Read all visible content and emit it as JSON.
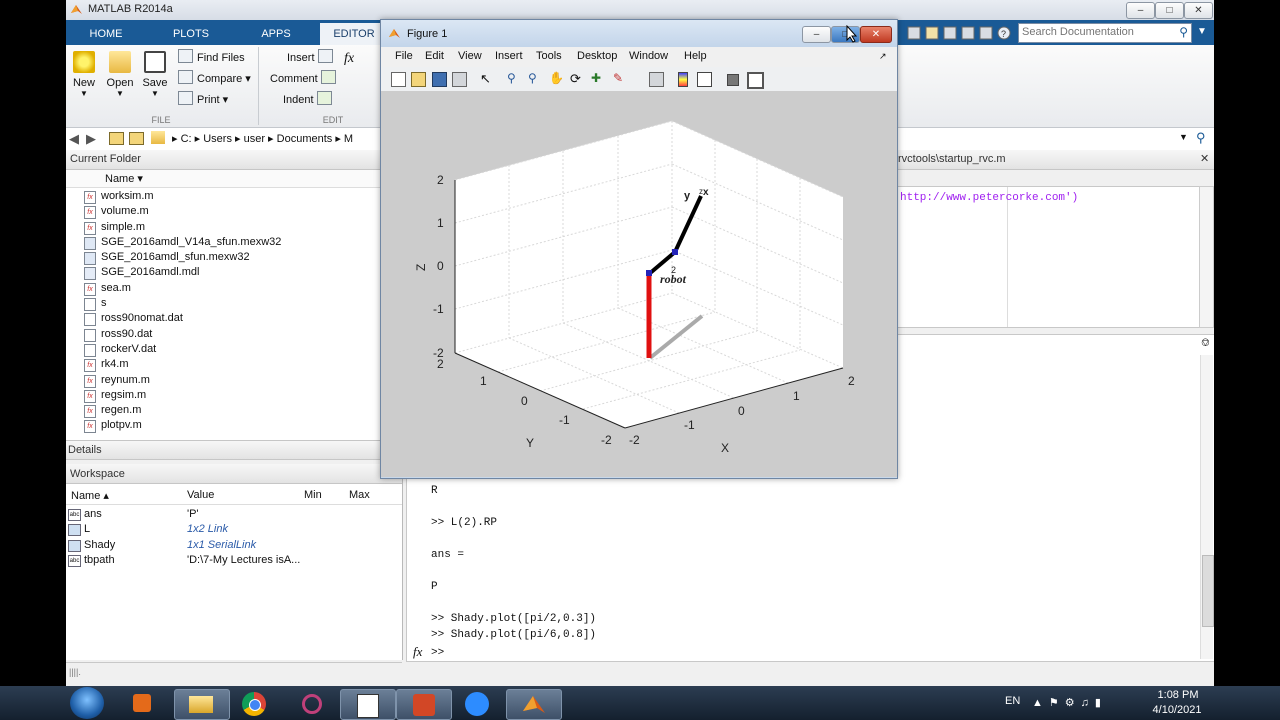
{
  "app": {
    "title": "MATLAB R2014a"
  },
  "tabs": [
    "HOME",
    "PLOTS",
    "APPS",
    "EDITOR"
  ],
  "ribbon": {
    "new": "New",
    "open": "Open",
    "save": "Save",
    "find_files": "Find Files",
    "compare": "Compare",
    "print": "Print",
    "insert": "Insert",
    "comment": "Comment",
    "indent": "Indent",
    "fx": "fx",
    "file_section": "FILE",
    "edit_section": "EDIT"
  },
  "search": {
    "placeholder": "Search Documentation"
  },
  "address": {
    "parts": [
      "C:",
      "Users",
      "user",
      "Documents",
      "M"
    ]
  },
  "current_folder": {
    "title": "Current Folder",
    "name_col": "Name ▾",
    "files": [
      {
        "name": "worksim.m",
        "icon": "m-file-icon"
      },
      {
        "name": "volume.m",
        "icon": "m-file-icon"
      },
      {
        "name": "simple.m",
        "icon": "m-file-icon"
      },
      {
        "name": "SGE_2016amdl_V14a_sfun.mexw32",
        "icon": "mex-file-icon"
      },
      {
        "name": "SGE_2016amdl_sfun.mexw32",
        "icon": "mex-file-icon"
      },
      {
        "name": "SGE_2016amdl.mdl",
        "icon": "model-file-icon"
      },
      {
        "name": "sea.m",
        "icon": "m-file-icon"
      },
      {
        "name": "s",
        "icon": "file-icon"
      },
      {
        "name": "ross90nomat.dat",
        "icon": "file-icon"
      },
      {
        "name": "ross90.dat",
        "icon": "file-icon"
      },
      {
        "name": "rockerV.dat",
        "icon": "file-icon"
      },
      {
        "name": "rk4.m",
        "icon": "m-file-icon"
      },
      {
        "name": "reynum.m",
        "icon": "m-file-icon"
      },
      {
        "name": "regsim.m",
        "icon": "m-file-icon"
      },
      {
        "name": "regen.m",
        "icon": "m-file-icon"
      },
      {
        "name": "plotpv.m",
        "icon": "m-file-icon"
      }
    ]
  },
  "details": {
    "title": "Details"
  },
  "workspace": {
    "title": "Workspace",
    "cols": {
      "name": "Name ▴",
      "value": "Value",
      "min": "Min",
      "max": "Max"
    },
    "rows": [
      {
        "name": "ans",
        "value": "'P'",
        "link": false
      },
      {
        "name": "L",
        "value": "1x2 Link",
        "link": true
      },
      {
        "name": "Shady",
        "value": "1x1 SerialLink",
        "link": true
      },
      {
        "name": "tbpath",
        "value": "'D:\\7-My Lectures isA...",
        "link": false
      }
    ]
  },
  "editor": {
    "tab": "rvctools\\startup_rvc.m",
    "line": "http://www.petercorke.com')"
  },
  "command_window": {
    "lines": [
      "R",
      "",
      ">> L(2).RP",
      "",
      "ans =",
      "",
      "P",
      "",
      ">> Shady.plot([pi/2,0.3])",
      ">> Shady.plot([pi/6,0.8])"
    ],
    "prompt": ">>",
    "fx": "fx"
  },
  "figure": {
    "title": "Figure 1",
    "menus": [
      "File",
      "Edit",
      "View",
      "Insert",
      "Tools",
      "Desktop",
      "Window",
      "Help"
    ],
    "plot": {
      "xlabel": "X",
      "ylabel": "Y",
      "zlabel": "Z",
      "x_ticks": [
        "-2",
        "-1",
        "0",
        "1",
        "2"
      ],
      "y_ticks": [
        "-2",
        "-1",
        "0",
        "1",
        "2"
      ],
      "z_ticks": [
        "-2",
        "-1",
        "0",
        "1",
        "2"
      ],
      "robot_label": "robot",
      "joint_label": "2",
      "frame_y": "y",
      "frame_x": "x",
      "frame_z": "z"
    }
  },
  "taskbar": {
    "lang": "EN",
    "time": "1:08 PM",
    "date": "4/10/2021"
  }
}
